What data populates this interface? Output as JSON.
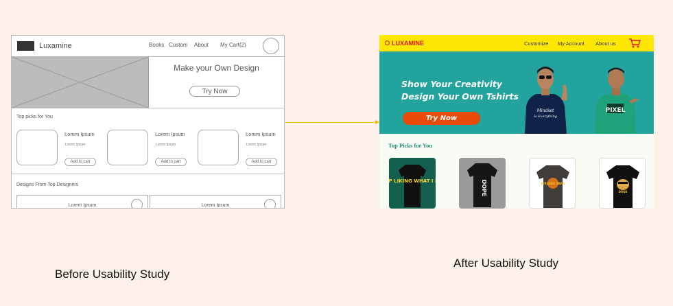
{
  "before": {
    "brand": "Luxamine",
    "nav": [
      "Books",
      "Custom",
      "About",
      "My Cart(2)"
    ],
    "hero_title": "Make your Own Design",
    "hero_button": "Try Now",
    "top_picks_title": "Top picks for You",
    "products": [
      {
        "title": "Lorem Ipsum",
        "subtitle": "Lorem Ipsum",
        "button": "Add to cart"
      },
      {
        "title": "Lorem Ipsum",
        "subtitle": "Lorem Ipsum",
        "button": "Add to cart"
      },
      {
        "title": "Lorem Ipsum",
        "subtitle": "Lorem Ipsum",
        "button": "Add to cart"
      }
    ],
    "designers_title": "Designs From Top Designers",
    "designers": [
      "Lorem Ipsum",
      "Lorem Ipsum"
    ]
  },
  "after": {
    "brand": "LUXAMINE",
    "nav": [
      "Customize",
      "My Account",
      "About us"
    ],
    "cart_icon": "cart-icon",
    "hero_line1": "Show Your Creativity",
    "hero_line2": "Design Your Own Tshirts",
    "hero_button": "Try Now",
    "top_picks_title": "Top Picks for You",
    "product_prints": [
      "STOP LIKING WHAT I LIKE",
      "DOPE",
      "JURASSIC PARK",
      "DOGE"
    ],
    "colors": {
      "topbar": "#ffe603",
      "hero": "#23a39d",
      "cta": "#e84a07",
      "heading": "#208a75"
    }
  },
  "captions": {
    "before": "Before Usability Study",
    "after": "After Usability Study"
  }
}
